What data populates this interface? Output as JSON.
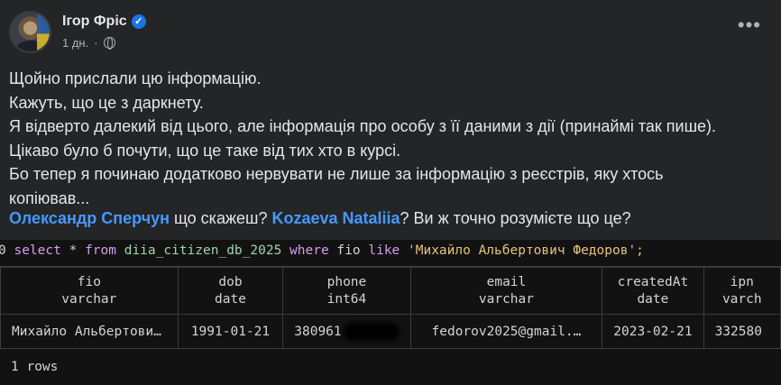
{
  "post": {
    "author": "Ігор Фріс",
    "time": "1 дн.",
    "lines": [
      "Щойно прислали цю інформацію.",
      "Кажуть, що це з даркнету.",
      "Я відверто далекий від цього, але інформація про особу з її даними з дії (принаймі так пише).",
      "Цікаво було б почути, що це таке від тих хто в курсі.",
      "Бо тепер я починаю додатково нервувати не лише за інформацію з реєстрів, яку хтось",
      "копіював..."
    ],
    "mention1": "Олександр Сперчун",
    "text1": " що скажеш? ",
    "mention2": "Kozaeva Nataliia",
    "text2": "? Ви ж точно розумієте що це?"
  },
  "terminal": {
    "prompt": "0 ",
    "kw_select": "select",
    "star": " * ",
    "kw_from": "from",
    "table": " diia_citizen_db_2025 ",
    "kw_where": "where",
    "field": " fio ",
    "kw_like": "like",
    "string": " 'Михайло Альбертович Федоров';",
    "columns": [
      {
        "name": "fio",
        "type": "varchar"
      },
      {
        "name": "dob",
        "type": "date"
      },
      {
        "name": "phone",
        "type": "int64"
      },
      {
        "name": "email",
        "type": "varchar"
      },
      {
        "name": "createdAt",
        "type": "date"
      },
      {
        "name": "ipn",
        "type": "varch"
      }
    ],
    "row": [
      "Михайло Альбертови…",
      "1991-01-21",
      "380961",
      "fedorov2025@gmail.…",
      "2023-02-21",
      "332580"
    ],
    "footer": "1 rows"
  }
}
